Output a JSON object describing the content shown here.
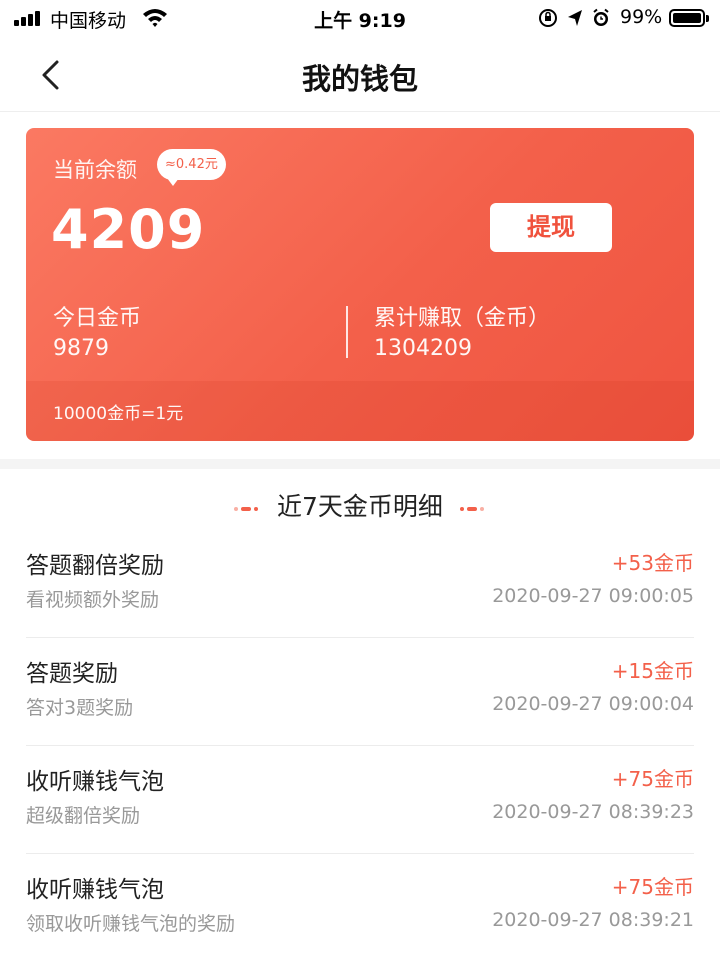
{
  "status_bar": {
    "carrier": "中国移动",
    "time": "上午 9:19",
    "battery": "99%"
  },
  "nav": {
    "title": "我的钱包"
  },
  "wallet": {
    "balance_label": "当前余额",
    "cash_equivalent": "≈0.42元",
    "balance": "4209",
    "withdraw_label": "提现",
    "today_label": "今日金币",
    "today_value": "9879",
    "total_label": "累计赚取（金币）",
    "total_value": "1304209",
    "rate": "10000金币=1元"
  },
  "history": {
    "title": "近7天金币明细",
    "items": [
      {
        "title": "答题翻倍奖励",
        "subtitle": "看视频额外奖励",
        "amount": "+53金币",
        "time": "2020-09-27 09:00:05"
      },
      {
        "title": "答题奖励",
        "subtitle": "答对3题奖励",
        "amount": "+15金币",
        "time": "2020-09-27 09:00:04"
      },
      {
        "title": "收听赚钱气泡",
        "subtitle": "超级翻倍奖励",
        "amount": "+75金币",
        "time": "2020-09-27 08:39:23"
      },
      {
        "title": "收听赚钱气泡",
        "subtitle": "领取收听赚钱气泡的奖励",
        "amount": "+75金币",
        "time": "2020-09-27 08:39:21"
      }
    ]
  },
  "colors": {
    "accent": "#f3604a",
    "card_gradient_start": "#fb7962",
    "card_gradient_end": "#ef5440"
  },
  "icons": [
    "signal-icon",
    "wifi-icon",
    "orientation-lock-icon",
    "location-icon",
    "alarm-icon",
    "battery-icon",
    "back-icon"
  ]
}
